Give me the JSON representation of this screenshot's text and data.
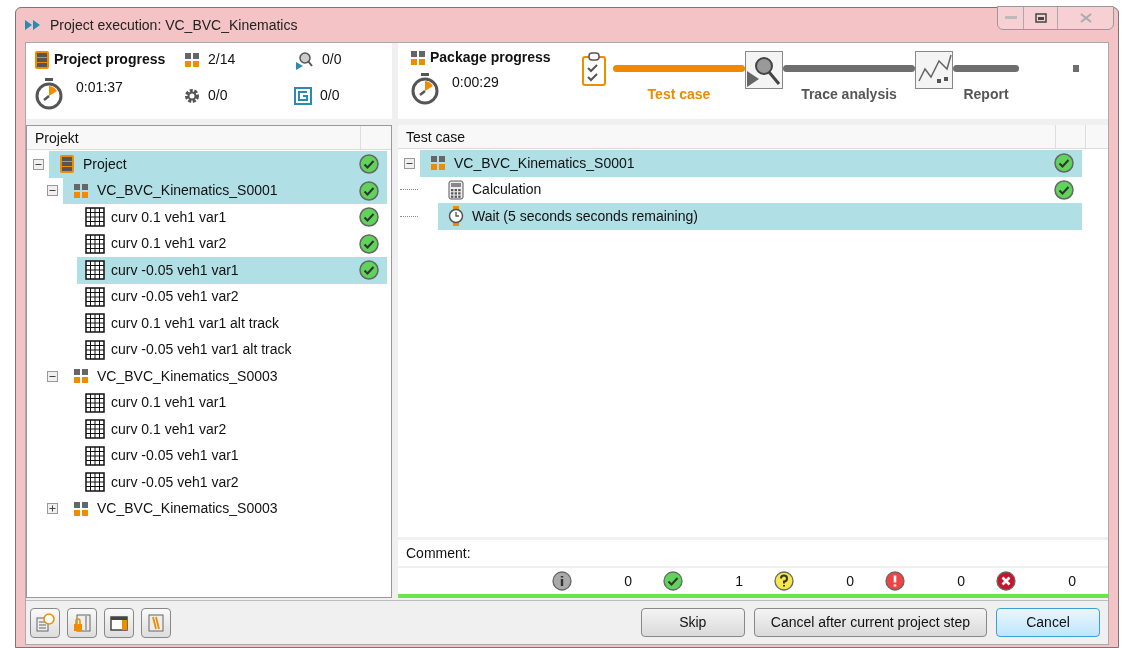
{
  "window": {
    "title": "Project execution: VC_BVC_Kinematics"
  },
  "project_progress": {
    "title": "Project progress",
    "time": "0:01:37",
    "packages": "2/14",
    "steps": "0/0",
    "traces": "0/0",
    "reports": "0/0"
  },
  "package_progress": {
    "title": "Package progress",
    "time": "0:00:29"
  },
  "pipeline": [
    {
      "kind": "testcase",
      "label": "Test case",
      "active": true
    },
    {
      "kind": "trace",
      "label": "Trace analysis",
      "active": false
    },
    {
      "kind": "report",
      "label": "Report",
      "active": false
    }
  ],
  "pipeline_tail": {
    "active": false
  },
  "project_tree": {
    "header": "Projekt",
    "items": [
      {
        "kind": "project",
        "label": "Project",
        "expanded": true,
        "selected": true,
        "passed": true,
        "children": [
          {
            "kind": "package",
            "label": "VC_BVC_Kinematics_S0001",
            "expanded": true,
            "selected": true,
            "passed": true,
            "children": [
              {
                "kind": "testcase",
                "label": "curv 0.1 veh1 var1",
                "selected": false,
                "passed": true
              },
              {
                "kind": "testcase",
                "label": "curv 0.1 veh1 var2",
                "selected": false,
                "passed": true
              },
              {
                "kind": "testcase",
                "label": "curv -0.05 veh1 var1",
                "selected": true,
                "passed": true
              },
              {
                "kind": "testcase",
                "label": "curv -0.05 veh1 var2",
                "selected": false,
                "passed": false
              },
              {
                "kind": "testcase",
                "label": "curv 0.1 veh1 var1 alt track",
                "selected": false,
                "passed": false
              },
              {
                "kind": "testcase",
                "label": "curv -0.05 veh1 var1 alt track",
                "selected": false,
                "passed": false
              }
            ]
          },
          {
            "kind": "package",
            "label": "VC_BVC_Kinematics_S0003",
            "expanded": true,
            "selected": false,
            "passed": false,
            "children": [
              {
                "kind": "testcase",
                "label": "curv 0.1 veh1 var1",
                "selected": false,
                "passed": false
              },
              {
                "kind": "testcase",
                "label": "curv 0.1 veh1 var2",
                "selected": false,
                "passed": false
              },
              {
                "kind": "testcase",
                "label": "curv -0.05 veh1 var1",
                "selected": false,
                "passed": false
              },
              {
                "kind": "testcase",
                "label": "curv -0.05 veh1 var2",
                "selected": false,
                "passed": false
              }
            ]
          },
          {
            "kind": "package",
            "label": "VC_BVC_Kinematics_S0003",
            "expanded": false,
            "selected": false,
            "passed": false
          }
        ]
      }
    ]
  },
  "testcase_tree": {
    "header": "Test case",
    "items": [
      {
        "kind": "package",
        "label": "VC_BVC_Kinematics_S0001",
        "expanded": true,
        "selected": true,
        "passed": true,
        "children": [
          {
            "kind": "calculation",
            "label": "Calculation",
            "selected": false,
            "passed": true
          },
          {
            "kind": "wait",
            "label": "Wait (5 seconds seconds remaining)",
            "selected": true,
            "passed": false
          }
        ]
      }
    ]
  },
  "comment": {
    "label": "Comment:"
  },
  "counts": [
    {
      "kind": "info",
      "value": "0"
    },
    {
      "kind": "passed",
      "value": "1"
    },
    {
      "kind": "question",
      "value": "0"
    },
    {
      "kind": "error",
      "value": "0"
    },
    {
      "kind": "failed",
      "value": "0"
    }
  ],
  "progress": {
    "level": 1
  },
  "tool_buttons": [
    {
      "kind": "log"
    },
    {
      "kind": "lock"
    },
    {
      "kind": "window"
    },
    {
      "kind": "book"
    }
  ],
  "buttons": [
    {
      "label": "Skip",
      "default": false
    },
    {
      "label": "Cancel after current project step",
      "default": false
    },
    {
      "label": "Cancel",
      "default": true
    }
  ]
}
